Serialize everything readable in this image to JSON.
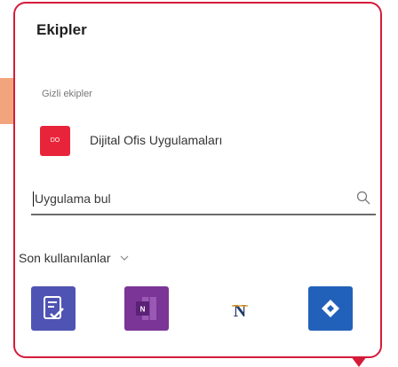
{
  "panel": {
    "title": "Ekipler",
    "hidden_teams_label": "Gizli ekipler",
    "team": {
      "avatar_text": "DO",
      "name": "Dijital Ofis Uygulamaları",
      "avatar_color": "#e8243a"
    }
  },
  "search": {
    "placeholder": "Uygulama bul",
    "value": "",
    "icon": "search-icon"
  },
  "recent": {
    "label": "Son kullanılanlar",
    "icon": "chevron-down-icon",
    "apps": [
      {
        "name": "forms-app-icon",
        "color": "#4f53b3"
      },
      {
        "name": "onenote-app-icon",
        "color": "#7a3596"
      },
      {
        "name": "n-app-icon",
        "color": "#ffffff"
      },
      {
        "name": "jira-app-icon",
        "color": "#2261b9"
      }
    ]
  },
  "colors": {
    "highlight_border": "#d51b3a",
    "side_tab": "#f2a57d"
  }
}
